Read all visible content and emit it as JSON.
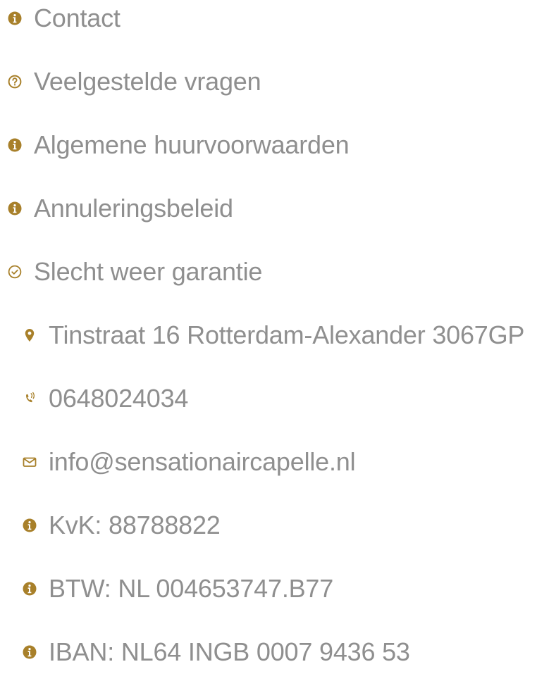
{
  "colors": {
    "icon": "#a8802a",
    "text": "#8f8f8f"
  },
  "links": [
    {
      "label": "Contact",
      "icon": "info-icon"
    },
    {
      "label": "Veelgestelde vragen",
      "icon": "question-circle-icon"
    },
    {
      "label": "Algemene huurvoorwaarden",
      "icon": "info-icon"
    },
    {
      "label": "Annuleringsbeleid",
      "icon": "info-icon"
    },
    {
      "label": "Slecht weer garantie",
      "icon": "check-circle-icon"
    }
  ],
  "contact": {
    "address": "Tinstraat 16 Rotterdam-Alexander 3067GP",
    "phone": "0648024034",
    "email": "info@sensationaircapelle.nl",
    "kvk": "KvK: 88788822",
    "btw": "BTW: NL 004653747.B77",
    "iban": "IBAN: NL64 INGB 0007 9436 53"
  }
}
